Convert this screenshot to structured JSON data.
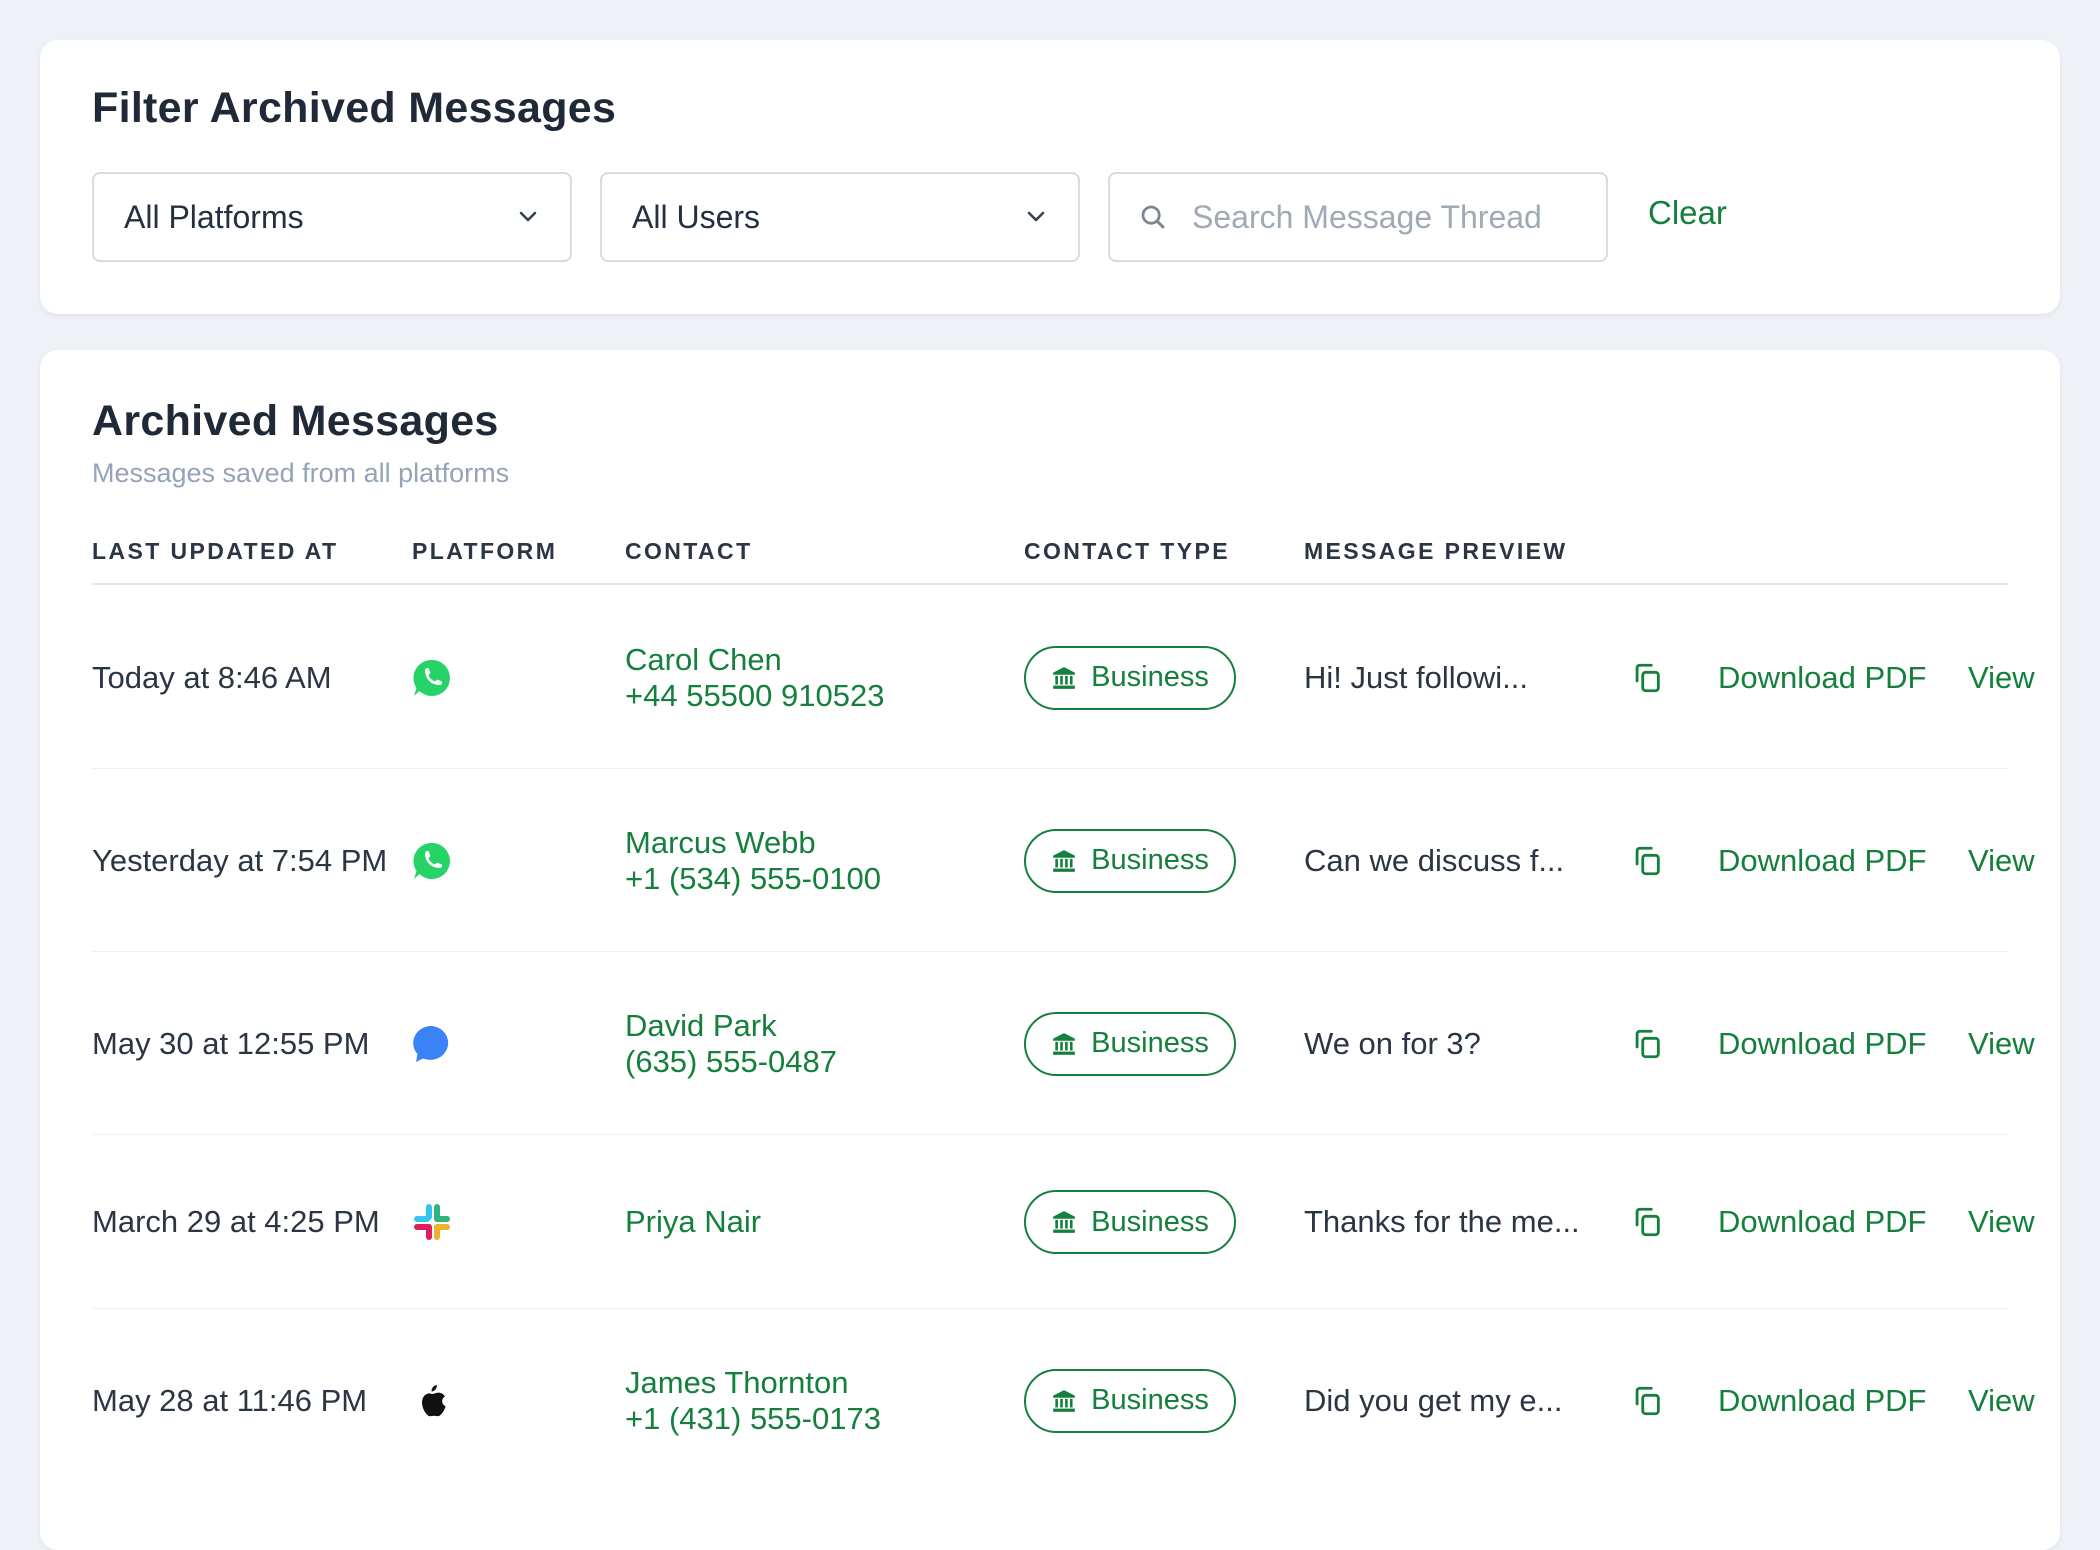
{
  "colors": {
    "accent": "#15803d",
    "background": "#eef1f6",
    "card": "#ffffff",
    "muted_text": "#94a3b8",
    "whatsapp": "#25d366",
    "messenger": "#3b82f6"
  },
  "filter": {
    "title": "Filter Archived Messages",
    "platform_select": {
      "value": "All Platforms",
      "icon": "chevron-down-icon"
    },
    "user_select": {
      "value": "All Users",
      "icon": "chevron-down-icon"
    },
    "search": {
      "placeholder": "Search Message Thread",
      "value": "",
      "icon": "search-icon"
    },
    "clear_label": "Clear"
  },
  "archive": {
    "title": "Archived Messages",
    "subtitle": "Messages saved from all platforms",
    "columns": [
      "LAST UPDATED AT",
      "PLATFORM",
      "CONTACT",
      "CONTACT TYPE",
      "MESSAGE PREVIEW"
    ],
    "rows": [
      {
        "time": "Today at 8:46 AM",
        "platform": "whatsapp-icon",
        "contact_name": "Carol Chen",
        "contact_phone": "+44 55500 910523",
        "contact_type": "Business",
        "preview": "Hi! Just followi...",
        "download_label": "Download PDF",
        "view_label": "View"
      },
      {
        "time": "Yesterday at 7:54 PM",
        "platform": "whatsapp-icon",
        "contact_name": "Marcus Webb",
        "contact_phone": "+1 (534) 555-0100",
        "contact_type": "Business",
        "preview": "Can we discuss f...",
        "download_label": "Download PDF",
        "view_label": "View"
      },
      {
        "time": "May 30 at 12:55 PM",
        "platform": "messenger-icon",
        "contact_name": "David Park",
        "contact_phone": "(635) 555-0487",
        "contact_type": "Business",
        "preview": "We on for 3?",
        "download_label": "Download PDF",
        "view_label": "View"
      },
      {
        "time": "March 29 at 4:25 PM",
        "platform": "slack-icon",
        "contact_name": "Priya Nair",
        "contact_phone": "",
        "contact_type": "Business",
        "preview": "Thanks for the me...",
        "download_label": "Download PDF",
        "view_label": "View"
      },
      {
        "time": "May 28 at 11:46 PM",
        "platform": "apple-icon",
        "contact_name": "James Thornton",
        "contact_phone": "+1 (431) 555-0173",
        "contact_type": "Business",
        "preview": "Did you get my e...",
        "download_label": "Download PDF",
        "view_label": "View"
      }
    ]
  }
}
